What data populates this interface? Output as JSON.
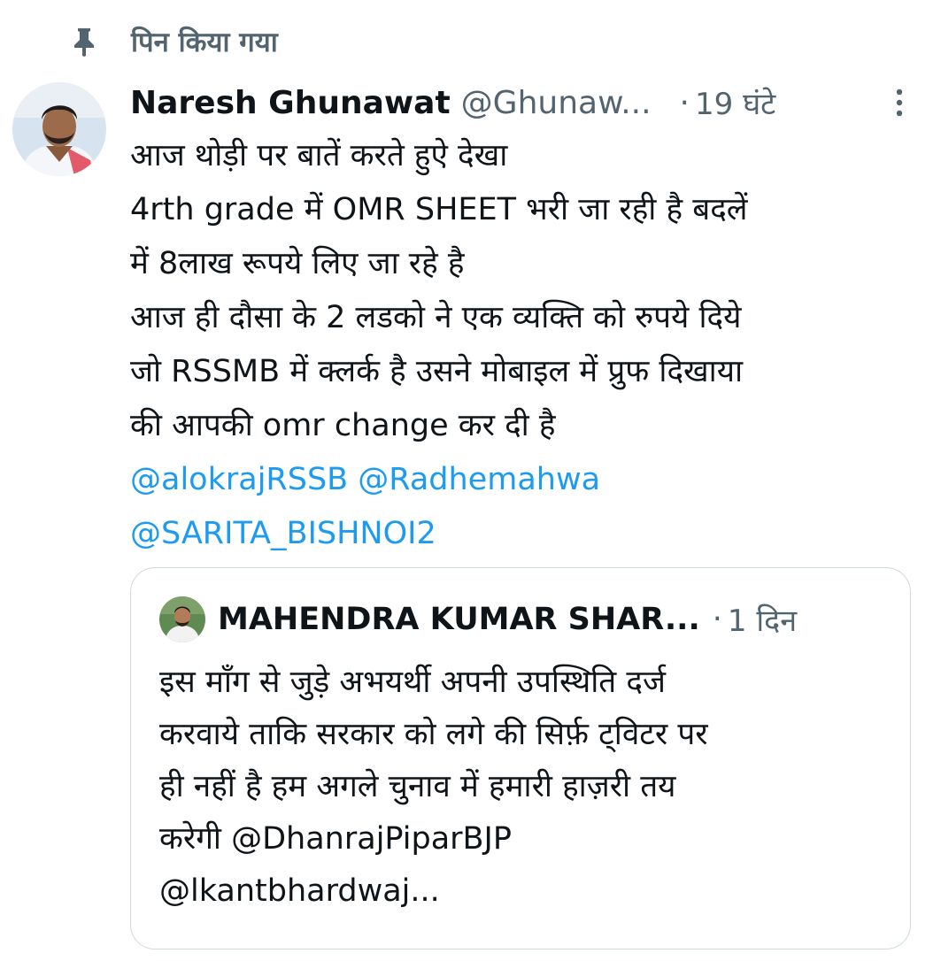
{
  "pinned": {
    "icon": "pin-icon",
    "label": "पिन किया गया"
  },
  "tweet": {
    "author_name": "Naresh Ghunawat",
    "author_handle": "@Ghunaw...",
    "dot": "·",
    "timestamp": "19 घंटे",
    "more_icon": "more-vertical-icon",
    "lines": [
      "आज थोड़ी पर बातें करते हुऐ देखा",
      "4rth grade में OMR SHEET  भरी जा रही है बदलें",
      "में 8लाख रूपये लिए जा रहे है",
      "आज ही दौसा के 2 लडको ने एक व्यक्ति को रुपये दिये",
      "जो RSSMB में क्लर्क है उसने मोबाइल में प्रुफ दिखाया",
      "की आपकी omr change कर दी है"
    ],
    "mentions_line_1": "@alokrajRSSB @Radhemahwa",
    "mentions_line_2": "@SARITA_BISHNOI2"
  },
  "quote": {
    "author_name": "MAHENDRA KUMAR SHAR...",
    "dot": "·",
    "timestamp": "1 दिन",
    "lines": [
      "इस माँग से जुड़े अभयर्थी अपनी उपस्थिति दर्ज",
      "करवाये ताकि सरकार को लगे की सिर्फ़ ट्विटर पर",
      "ही नहीं है हम अगले चुनाव में हमारी हाज़री तय",
      "करेगी @DhanrajPiparBJP",
      "@lkantbhardwaj..."
    ]
  },
  "colors": {
    "text_primary": "#0f1419",
    "text_secondary": "#536471",
    "link": "#1d9bf0",
    "border": "#cfd9de"
  }
}
